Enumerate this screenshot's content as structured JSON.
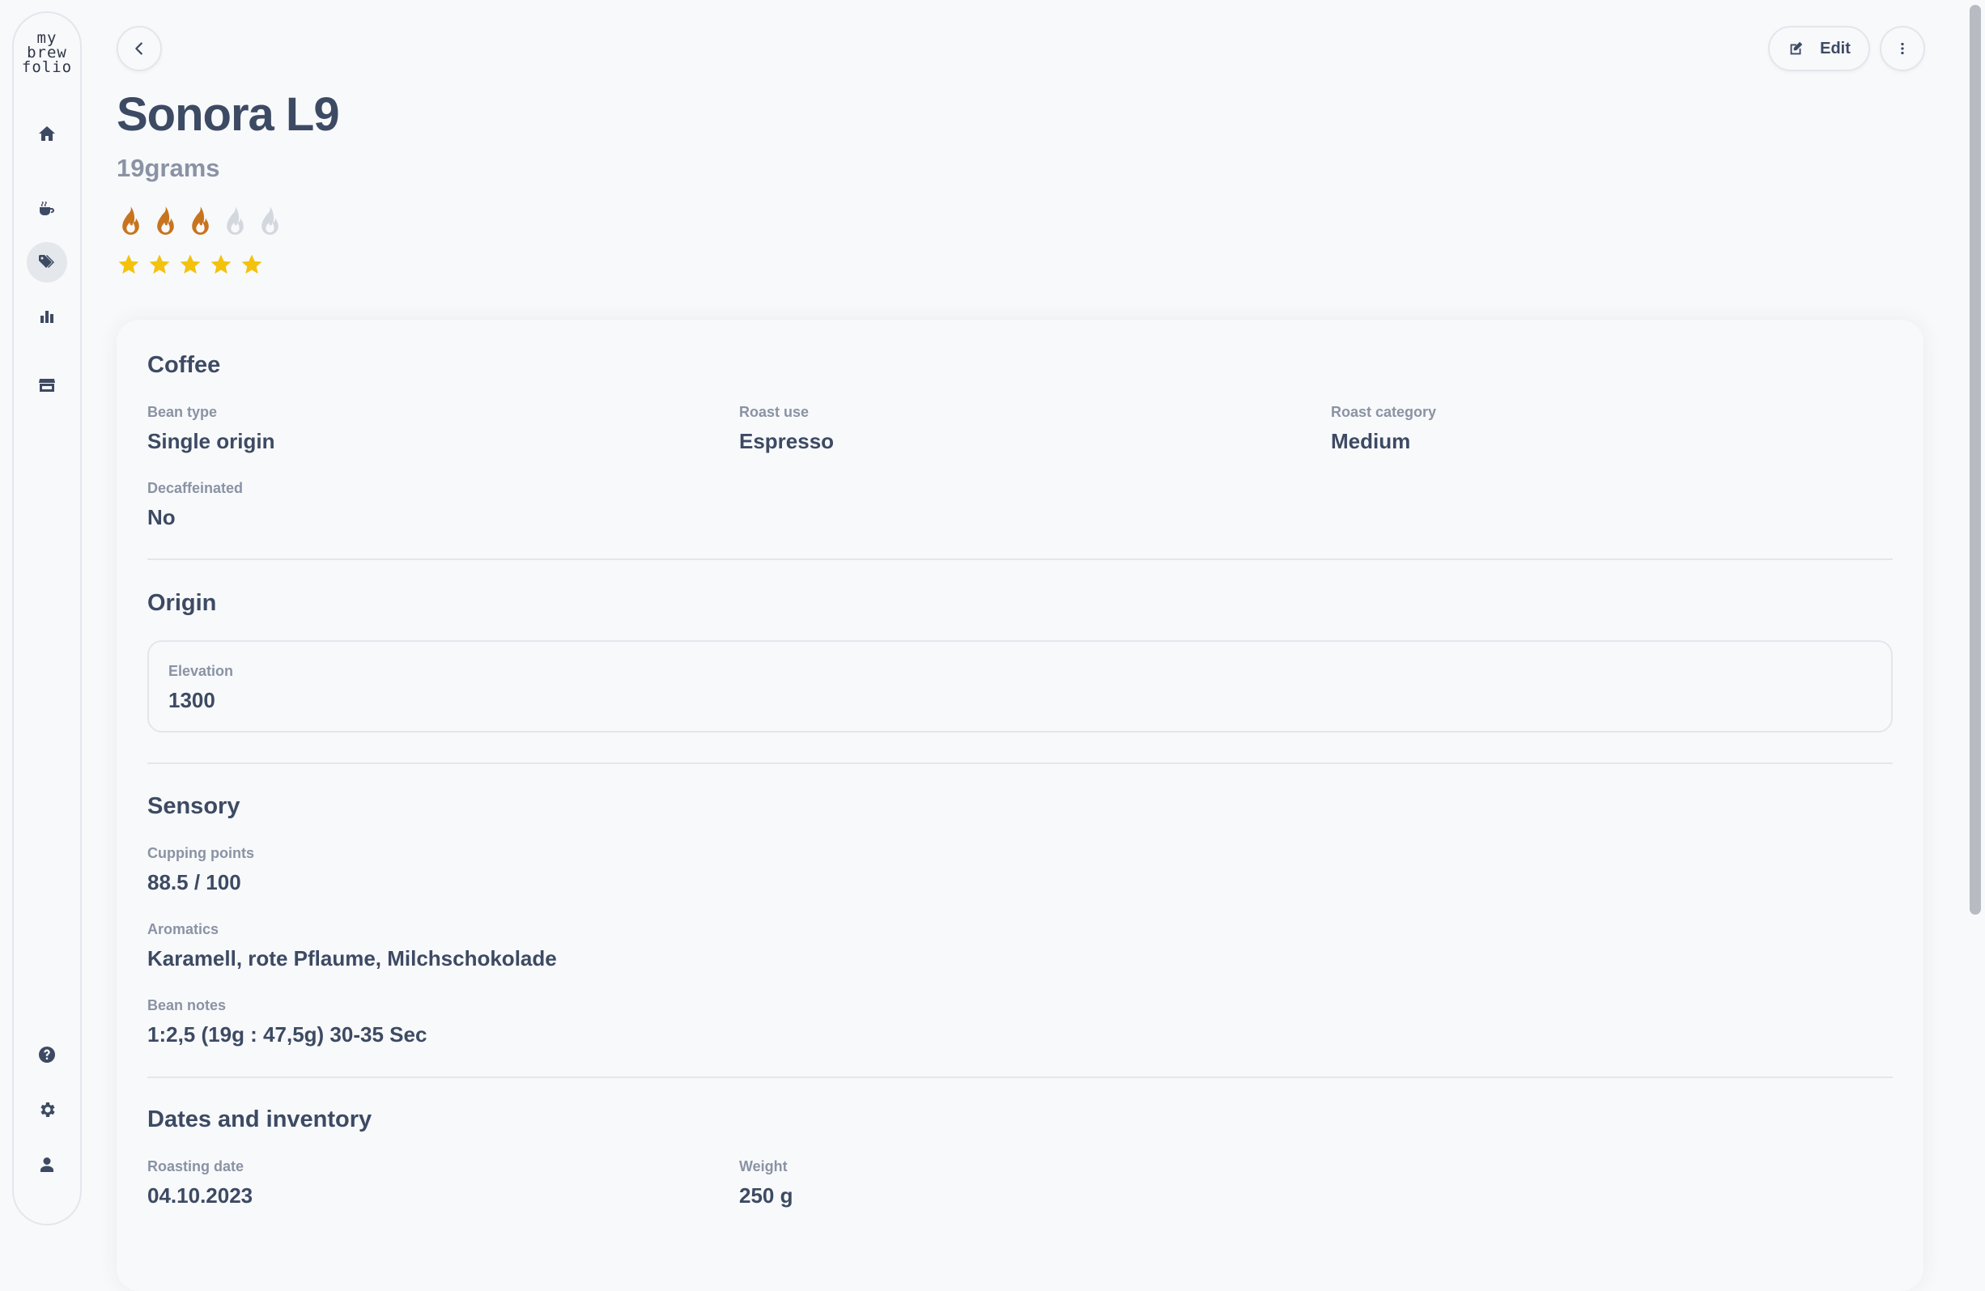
{
  "app": {
    "logo_lines": [
      "my",
      "brew",
      "folio"
    ]
  },
  "sidebar": {
    "items": [
      {
        "name": "home",
        "icon": "home-icon",
        "active": false
      },
      {
        "name": "brews",
        "icon": "coffee-cup-icon",
        "active": false
      },
      {
        "name": "beans",
        "icon": "tags-icon",
        "active": true
      },
      {
        "name": "statistics",
        "icon": "bar-chart-icon",
        "active": false
      },
      {
        "name": "roasteries",
        "icon": "store-icon",
        "active": false
      }
    ],
    "bottom_items": [
      {
        "name": "help",
        "icon": "question-circle-icon"
      },
      {
        "name": "settings",
        "icon": "gear-icon"
      },
      {
        "name": "profile",
        "icon": "user-icon"
      }
    ]
  },
  "header": {
    "edit_label": "Edit"
  },
  "bean": {
    "name": "Sonora L9",
    "roaster": "19grams",
    "roast_level": 3,
    "roast_level_max": 5,
    "rating": 5,
    "rating_max": 5
  },
  "sections": {
    "coffee": {
      "title": "Coffee",
      "bean_type_label": "Bean type",
      "bean_type": "Single origin",
      "roast_use_label": "Roast use",
      "roast_use": "Espresso",
      "roast_category_label": "Roast category",
      "roast_category": "Medium",
      "decaf_label": "Decaffeinated",
      "decaf": "No"
    },
    "origin": {
      "title": "Origin",
      "elevation_label": "Elevation",
      "elevation": "1300"
    },
    "sensory": {
      "title": "Sensory",
      "cupping_label": "Cupping points",
      "cupping": "88.5 / 100",
      "aromatics_label": "Aromatics",
      "aromatics": "Karamell, rote Pflaume, Milchschokolade",
      "notes_label": "Bean notes",
      "notes": "1:2,5 (19g : 47,5g) 30-35 Sec"
    },
    "dates": {
      "title": "Dates and inventory",
      "roasting_date_label": "Roasting date",
      "roasting_date": "04.10.2023",
      "weight_label": "Weight",
      "weight": "250 g"
    }
  },
  "colors": {
    "flame_active": "#c8741f",
    "flame_inactive": "#d3d7de",
    "star": "#f4c20d",
    "text": "#3d4a63",
    "muted": "#8a93a4"
  }
}
